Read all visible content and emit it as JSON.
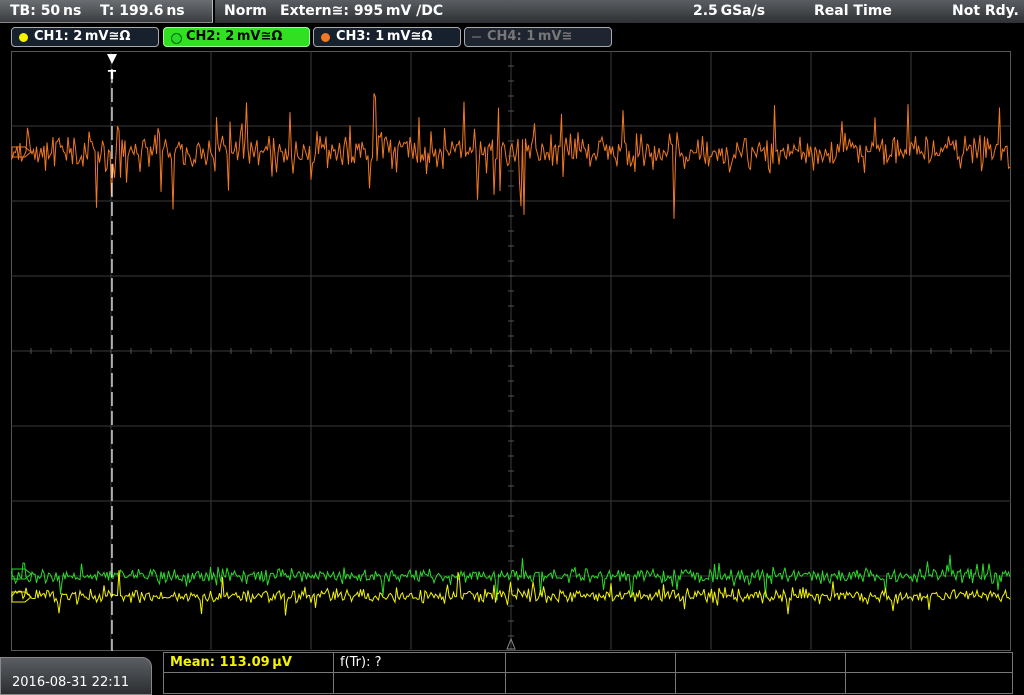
{
  "top": {
    "timebase": "TB: 50 ns",
    "trigger_time": "T: 199.6 ns",
    "mode": "Norm",
    "trigger": "Extern≅: 995 mV ∕DC",
    "sample_rate": "2.5 GSa/s",
    "acq_mode": "Real Time",
    "status": "Not Rdy."
  },
  "channels": [
    {
      "label": "CH1: 2 mV≅Ω",
      "color": "#f4f400"
    },
    {
      "label": "CH2: 2 mV≅Ω",
      "color": "#2bd92b"
    },
    {
      "label": "CH3: 1 mV≅Ω",
      "color": "#f07820"
    },
    {
      "label": "CH4: 1 mV≅",
      "color": "#6a6a6a"
    }
  ],
  "bottom": {
    "datetime": "2016-08-31 22:11",
    "mean": "Mean: 113.09 µV",
    "f_tr": "f(Tr): ?"
  },
  "trigger_marker": "T",
  "display": {
    "grid_color": "#3a3a3a",
    "background": "#000000"
  }
}
